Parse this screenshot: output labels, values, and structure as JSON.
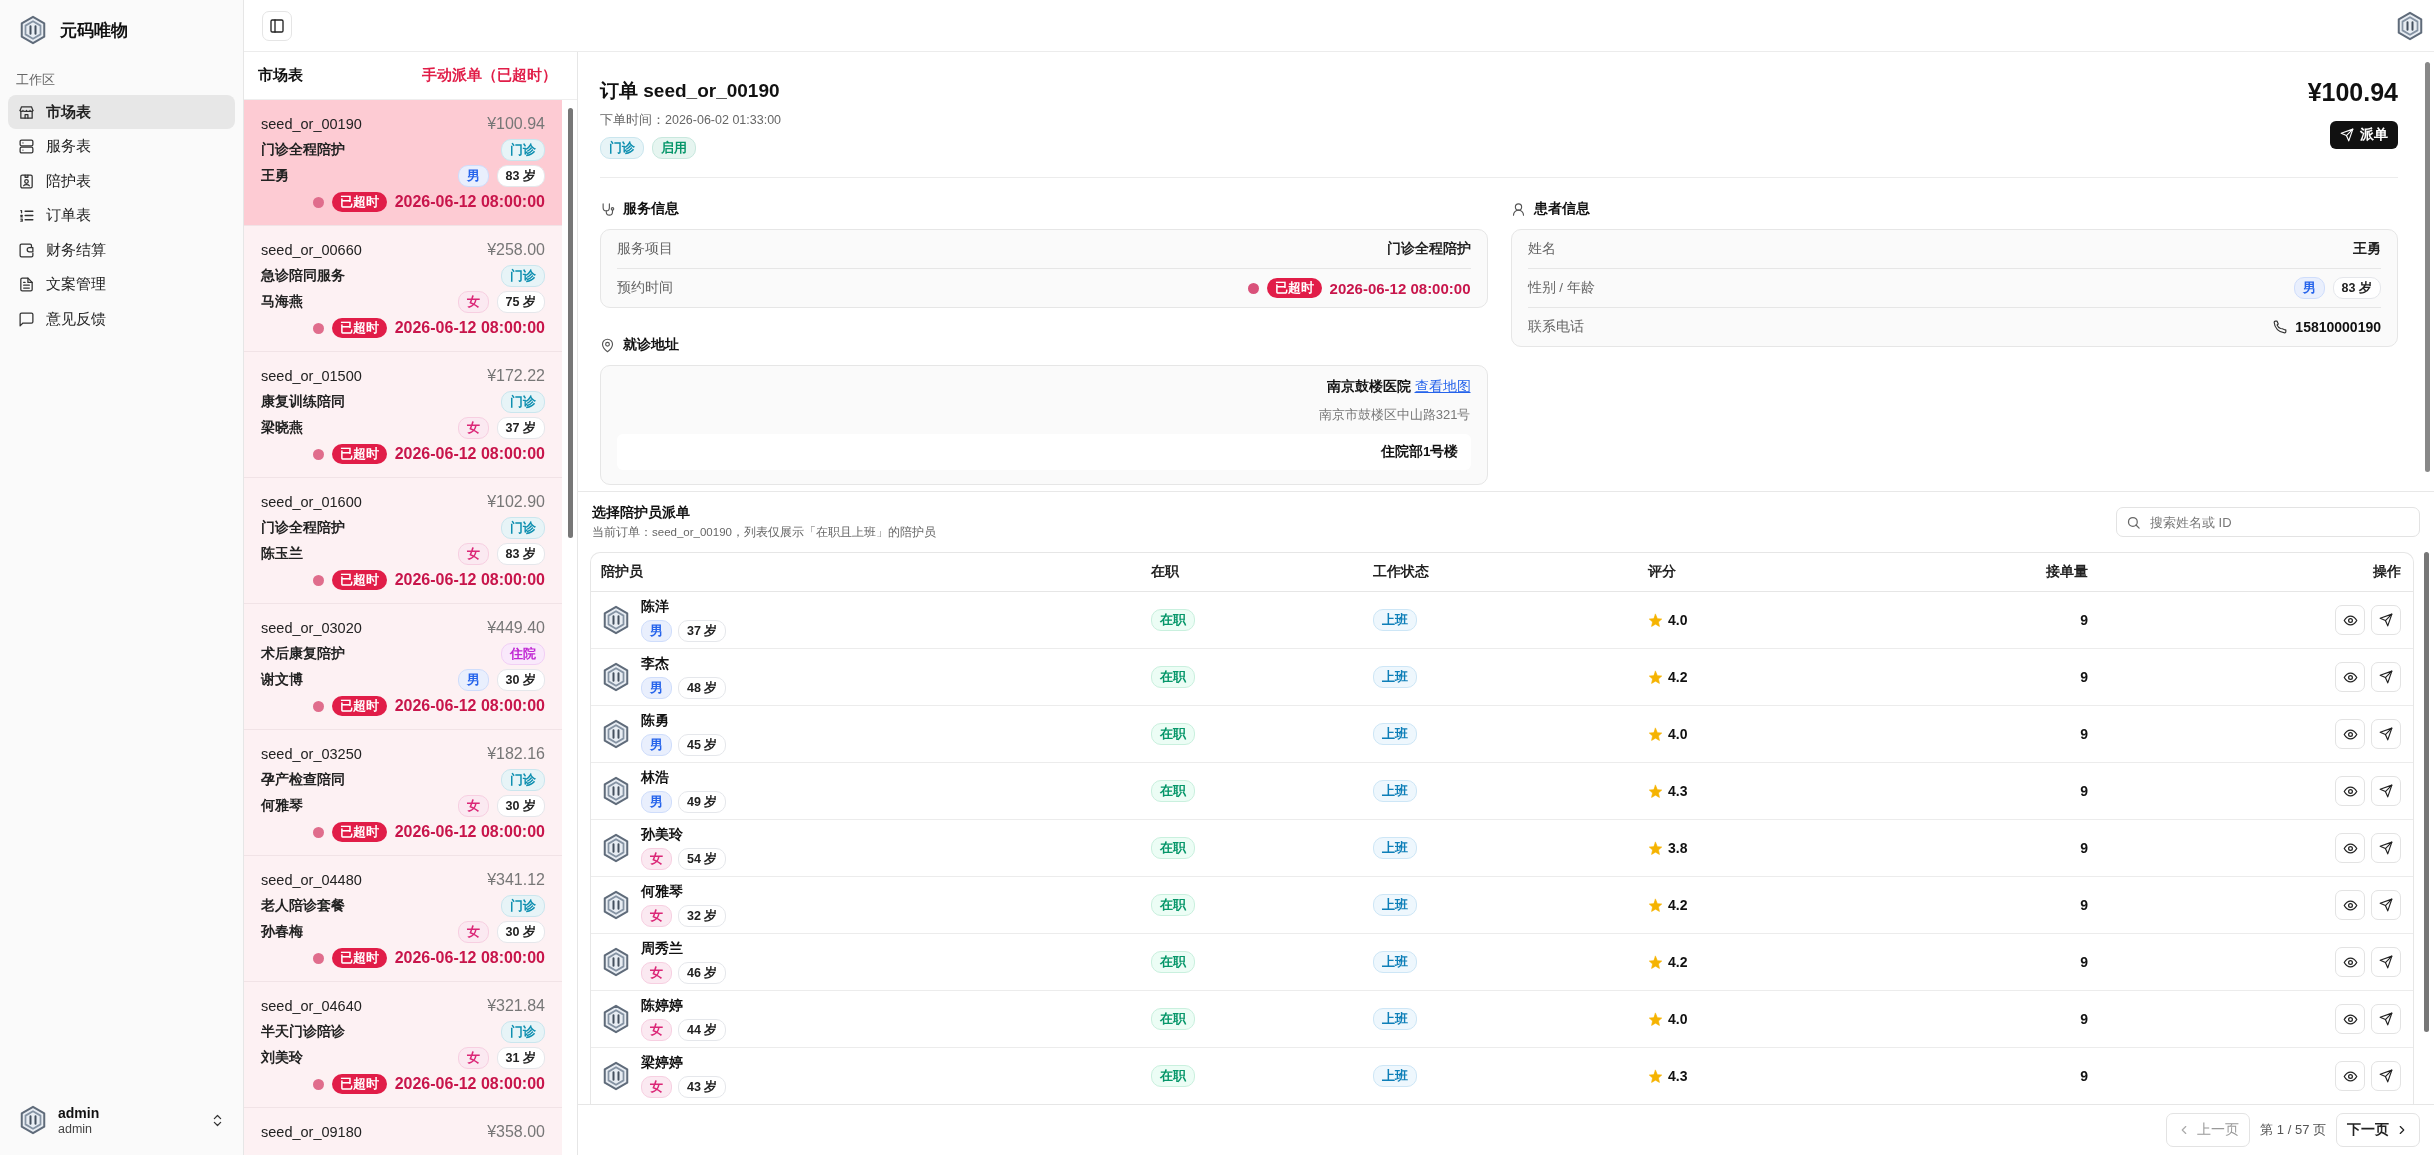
{
  "sidebar": {
    "brand": "元码唯物",
    "section": "工作区",
    "items": [
      {
        "label": "市场表",
        "selected": true
      },
      {
        "label": "服务表",
        "selected": false
      },
      {
        "label": "陪护表",
        "selected": false
      },
      {
        "label": "订单表",
        "selected": false
      },
      {
        "label": "财务结算",
        "selected": false
      },
      {
        "label": "文案管理",
        "selected": false
      },
      {
        "label": "意见反馈",
        "selected": false
      }
    ],
    "user": {
      "name": "admin",
      "role": "admin"
    }
  },
  "market": {
    "title": "市场表",
    "mode": "手动派单（已超时）",
    "orders": [
      {
        "id": "seed_or_00190",
        "price": "¥100.94",
        "service": "门诊全程陪护",
        "type": {
          "text": "门诊",
          "color": "#0e8fb0"
        },
        "patient": "王勇",
        "gender": {
          "text": "男",
          "color": "#2563eb"
        },
        "age": "83 岁",
        "status": "已超时",
        "time": "2026-06-12 08:00:00",
        "selected": true
      },
      {
        "id": "seed_or_00660",
        "price": "¥258.00",
        "service": "急诊陪同服务",
        "type": {
          "text": "门诊",
          "color": "#0e8fb0"
        },
        "patient": "马海燕",
        "gender": {
          "text": "女",
          "color": "#db2777"
        },
        "age": "75 岁",
        "status": "已超时",
        "time": "2026-06-12 08:00:00",
        "selected": false
      },
      {
        "id": "seed_or_01500",
        "price": "¥172.22",
        "service": "康复训练陪同",
        "type": {
          "text": "门诊",
          "color": "#0e8fb0"
        },
        "patient": "梁晓燕",
        "gender": {
          "text": "女",
          "color": "#db2777"
        },
        "age": "37 岁",
        "status": "已超时",
        "time": "2026-06-12 08:00:00",
        "selected": false
      },
      {
        "id": "seed_or_01600",
        "price": "¥102.90",
        "service": "门诊全程陪护",
        "type": {
          "text": "门诊",
          "color": "#0e8fb0"
        },
        "patient": "陈玉兰",
        "gender": {
          "text": "女",
          "color": "#db2777"
        },
        "age": "83 岁",
        "status": "已超时",
        "time": "2026-06-12 08:00:00",
        "selected": false
      },
      {
        "id": "seed_or_03020",
        "price": "¥449.40",
        "service": "术后康复陪护",
        "type": {
          "text": "住院",
          "color": "#c026d3"
        },
        "patient": "谢文博",
        "gender": {
          "text": "男",
          "color": "#2563eb"
        },
        "age": "30 岁",
        "status": "已超时",
        "time": "2026-06-12 08:00:00",
        "selected": false
      },
      {
        "id": "seed_or_03250",
        "price": "¥182.16",
        "service": "孕产检查陪同",
        "type": {
          "text": "门诊",
          "color": "#0e8fb0"
        },
        "patient": "何雅琴",
        "gender": {
          "text": "女",
          "color": "#db2777"
        },
        "age": "30 岁",
        "status": "已超时",
        "time": "2026-06-12 08:00:00",
        "selected": false
      },
      {
        "id": "seed_or_04480",
        "price": "¥341.12",
        "service": "老人陪诊套餐",
        "type": {
          "text": "门诊",
          "color": "#0e8fb0"
        },
        "patient": "孙春梅",
        "gender": {
          "text": "女",
          "color": "#db2777"
        },
        "age": "30 岁",
        "status": "已超时",
        "time": "2026-06-12 08:00:00",
        "selected": false
      },
      {
        "id": "seed_or_04640",
        "price": "¥321.84",
        "service": "半天门诊陪诊",
        "type": {
          "text": "门诊",
          "color": "#0e8fb0"
        },
        "patient": "刘美玲",
        "gender": {
          "text": "女",
          "color": "#db2777"
        },
        "age": "31 岁",
        "status": "已超时",
        "time": "2026-06-12 08:00:00",
        "selected": false
      },
      {
        "id": "seed_or_09180",
        "price": "¥358.00",
        "selected": false
      }
    ]
  },
  "detail": {
    "title": "订单 seed_or_00190",
    "created": "下单时间：2026-06-02 01:33:00",
    "tags": [
      {
        "text": "门诊",
        "color": "#0e8fb0"
      },
      {
        "text": "启用",
        "color": "#059669"
      }
    ],
    "price": "¥100.94",
    "dispatch_button": "派单",
    "service": {
      "title": "服务信息",
      "rows": [
        {
          "kind": "text",
          "label": "服务项目",
          "value": "门诊全程陪护"
        },
        {
          "kind": "overdue",
          "label": "预约时间",
          "status": "已超时",
          "value": "2026-06-12 08:00:00"
        }
      ]
    },
    "address": {
      "title": "就诊地址",
      "hospital": "南京鼓楼医院",
      "map_link": "查看地图",
      "street": "南京市鼓楼区中山路321号",
      "building": "住院部1号楼"
    },
    "patient": {
      "title": "患者信息",
      "rows": [
        {
          "kind": "text",
          "label": "姓名",
          "value": "王勇"
        },
        {
          "kind": "gender_age",
          "label": "性别 / 年龄",
          "gender": {
            "text": "男",
            "color": "#2563eb"
          },
          "age": "83 岁"
        },
        {
          "kind": "phone",
          "label": "联系电话",
          "value": "15810000190"
        }
      ]
    }
  },
  "dispatch": {
    "title": "选择陪护员派单",
    "subtitle": "当前订单：seed_or_00190，列表仅展示「在职且上班」的陪护员",
    "search_placeholder": "搜索姓名或 ID",
    "columns": [
      "陪护员",
      "在职",
      "工作状态",
      "评分",
      "接单量",
      "操作"
    ],
    "rows": [
      {
        "name": "陈洋",
        "gender": {
          "text": "男",
          "color": "#2563eb"
        },
        "age": "37 岁",
        "employment": "在职",
        "work_status": "上班",
        "rating": "4.0",
        "orders": "9"
      },
      {
        "name": "李杰",
        "gender": {
          "text": "男",
          "color": "#2563eb"
        },
        "age": "48 岁",
        "employment": "在职",
        "work_status": "上班",
        "rating": "4.2",
        "orders": "9"
      },
      {
        "name": "陈勇",
        "gender": {
          "text": "男",
          "color": "#2563eb"
        },
        "age": "45 岁",
        "employment": "在职",
        "work_status": "上班",
        "rating": "4.0",
        "orders": "9"
      },
      {
        "name": "林浩",
        "gender": {
          "text": "男",
          "color": "#2563eb"
        },
        "age": "49 岁",
        "employment": "在职",
        "work_status": "上班",
        "rating": "4.3",
        "orders": "9"
      },
      {
        "name": "孙美玲",
        "gender": {
          "text": "女",
          "color": "#db2777"
        },
        "age": "54 岁",
        "employment": "在职",
        "work_status": "上班",
        "rating": "3.8",
        "orders": "9"
      },
      {
        "name": "何雅琴",
        "gender": {
          "text": "女",
          "color": "#db2777"
        },
        "age": "32 岁",
        "employment": "在职",
        "work_status": "上班",
        "rating": "4.2",
        "orders": "9"
      },
      {
        "name": "周秀兰",
        "gender": {
          "text": "女",
          "color": "#db2777"
        },
        "age": "46 岁",
        "employment": "在职",
        "work_status": "上班",
        "rating": "4.2",
        "orders": "9"
      },
      {
        "name": "陈婷婷",
        "gender": {
          "text": "女",
          "color": "#db2777"
        },
        "age": "44 岁",
        "employment": "在职",
        "work_status": "上班",
        "rating": "4.0",
        "orders": "9"
      },
      {
        "name": "梁婷婷",
        "gender": {
          "text": "女",
          "color": "#db2777"
        },
        "age": "43 岁",
        "employment": "在职",
        "work_status": "上班",
        "rating": "4.3",
        "orders": "9"
      }
    ],
    "pagination": {
      "prev": "上一页",
      "prev_disabled": true,
      "page": "第 1 / 57 页",
      "next": "下一页"
    }
  }
}
